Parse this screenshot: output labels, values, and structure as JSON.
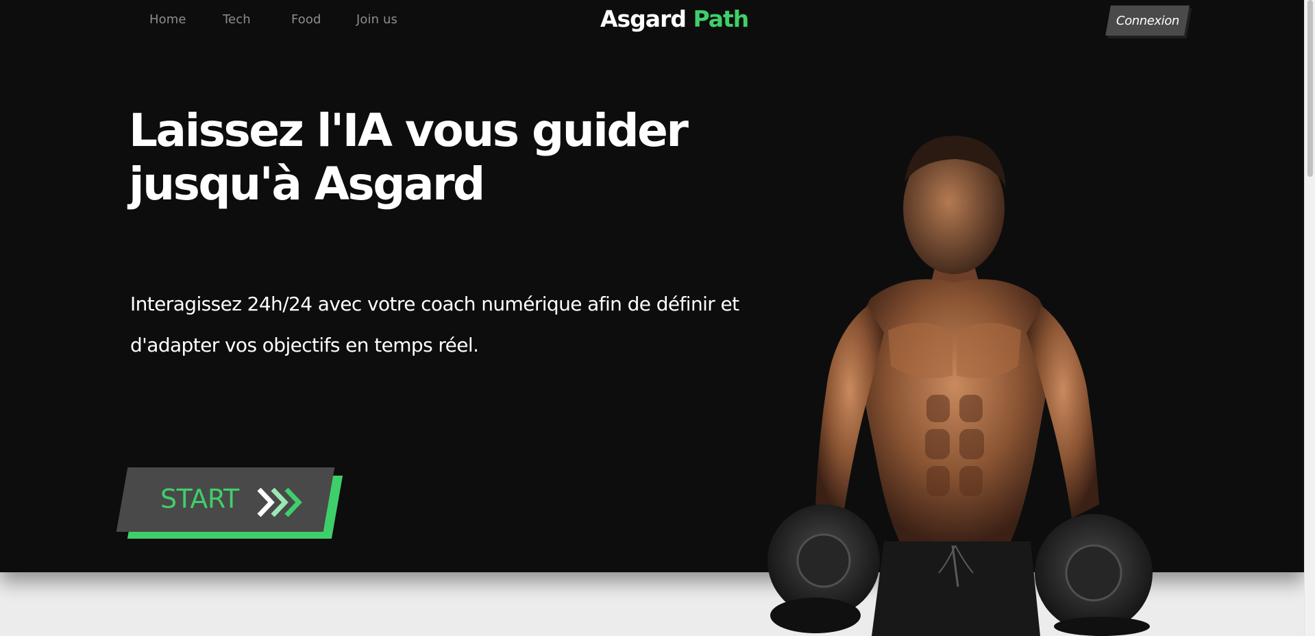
{
  "nav": {
    "links": [
      "Home",
      "Tech",
      "Food",
      "Join us"
    ]
  },
  "logo": {
    "part1": "Asgard ",
    "part2": "Path"
  },
  "header": {
    "connexion_label": "Connexion"
  },
  "hero": {
    "headline": "Laissez l'IA vous guider jusqu'à Asgard",
    "subtext": "Interagissez 24h/24 avec votre coach numérique afin de définir et d'adapter vos objectifs en temps réel.",
    "start_label": "START"
  },
  "icons": {
    "start_arrows": "triple-chevron-right-icon",
    "image": "athlete-with-dumbbells-image"
  },
  "colors": {
    "accent": "#3fcf6a",
    "hero_bg": "#0d0d0d",
    "button_bg": "#494949",
    "page_bg": "#ececec"
  }
}
